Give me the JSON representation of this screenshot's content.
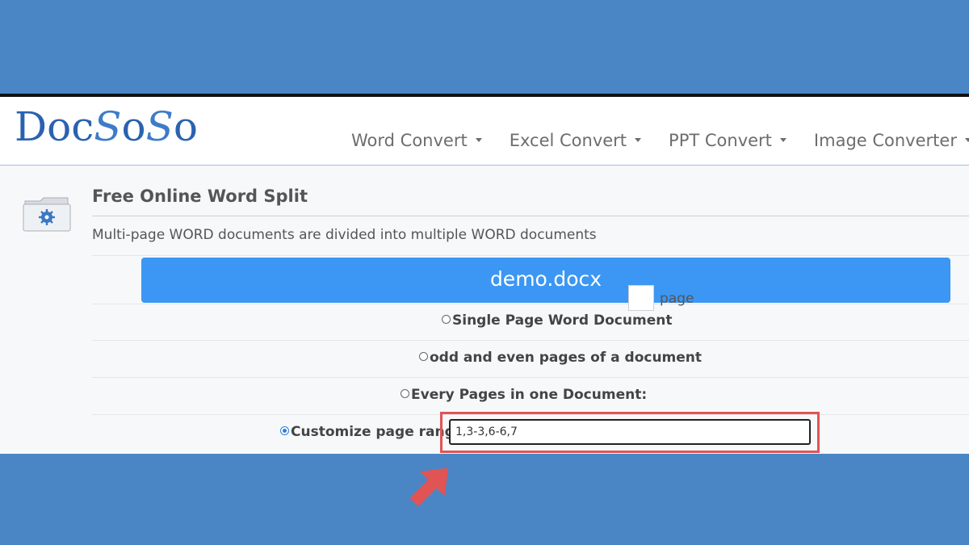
{
  "logo": {
    "part1": "Doc",
    "s1": "S",
    "part2": "o",
    "s2": "S",
    "part3": "o"
  },
  "nav": [
    {
      "label": "Word Convert"
    },
    {
      "label": "Excel Convert"
    },
    {
      "label": "PPT Convert"
    },
    {
      "label": "Image Converter"
    }
  ],
  "page": {
    "title": "Free Online Word Split",
    "description": "Multi-page WORD documents are divided into multiple WORD documents"
  },
  "file": {
    "name": "demo.docx"
  },
  "options": [
    {
      "label": "Single Page Word Document",
      "checked": false
    },
    {
      "label": "odd and even pages of a document",
      "checked": false
    },
    {
      "label": "Every Pages in one Document:",
      "checked": false,
      "suffix": "page"
    },
    {
      "label": "Customize page range",
      "checked": true,
      "value": "1,3-3,6-6,7"
    }
  ],
  "colors": {
    "background": "#4a86c5",
    "accent": "#3b97f3",
    "highlight": "#e15454",
    "arrow": "#e15454"
  }
}
